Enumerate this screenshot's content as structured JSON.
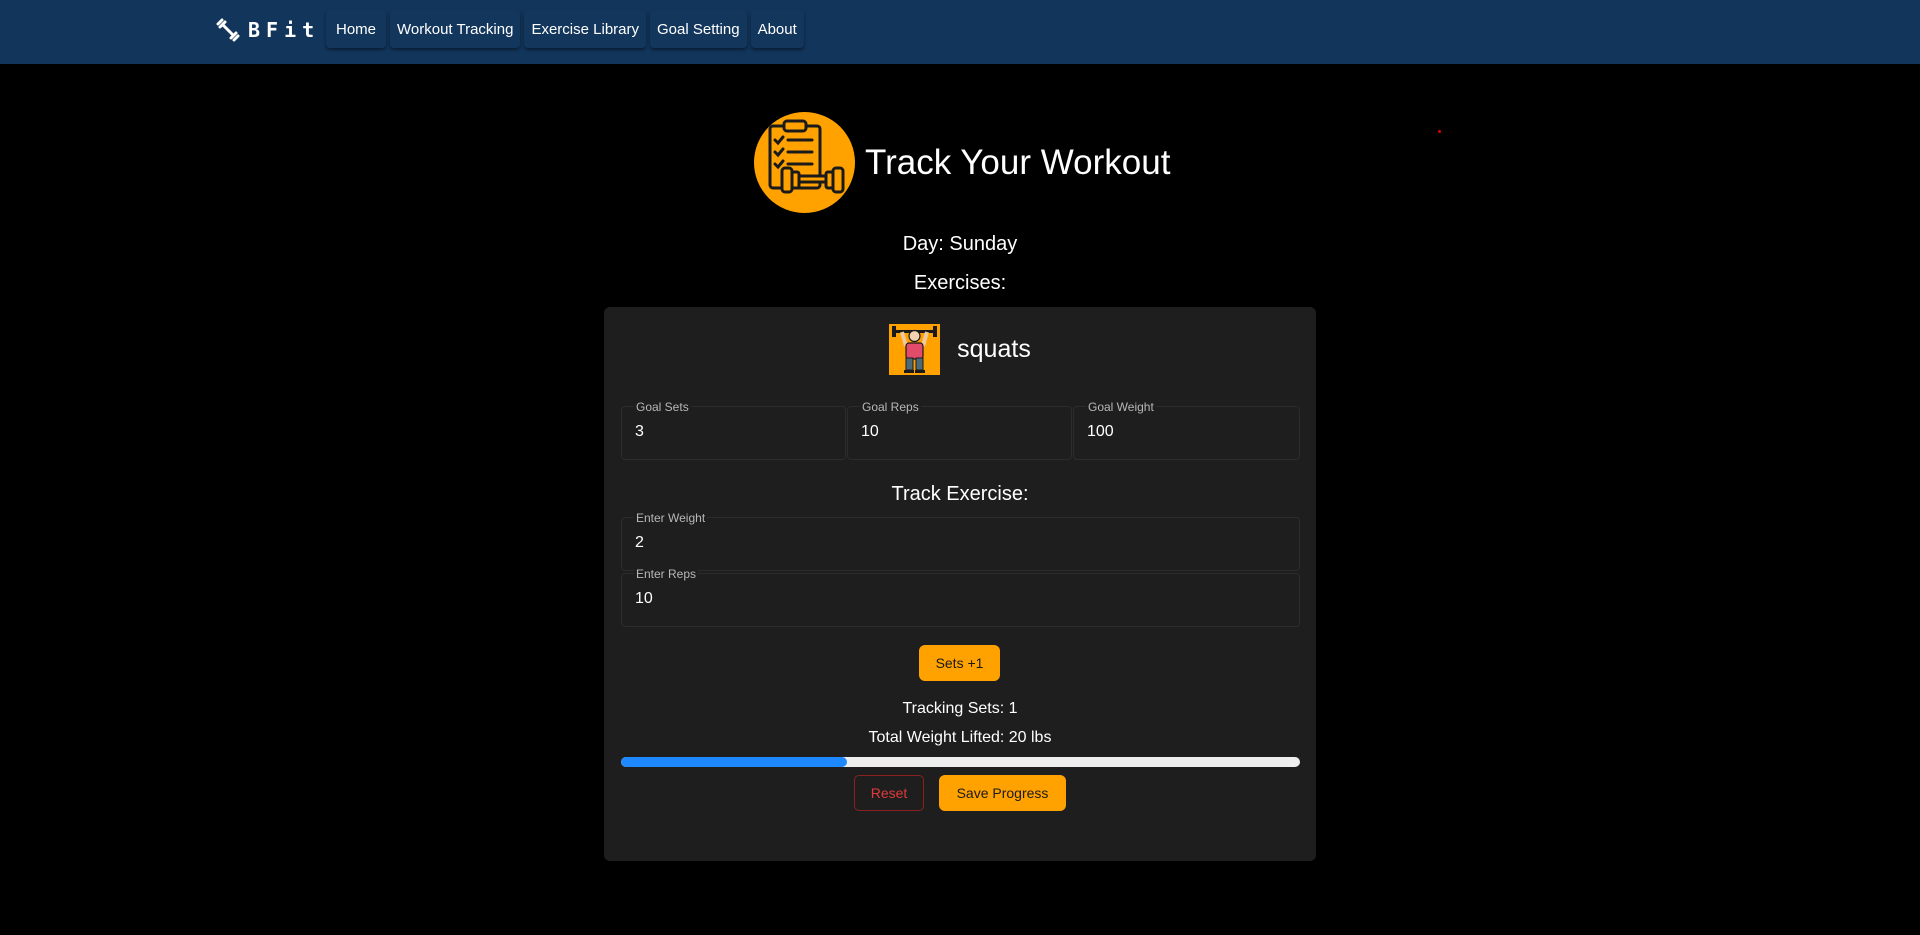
{
  "nav": {
    "brand": "BFit",
    "brand_icon": "dumbbell-icon",
    "links": [
      {
        "label": "Home"
      },
      {
        "label": "Workout Tracking"
      },
      {
        "label": "Exercise Library"
      },
      {
        "label": "Goal Setting"
      },
      {
        "label": "About"
      }
    ]
  },
  "header": {
    "title": "Track Your Workout",
    "icon": "clipboard-dumbbell-icon"
  },
  "day": "Day: Sunday",
  "exercises_label": "Exercises:",
  "exercise": {
    "name": "squats",
    "thumb_icon": "weightlifter-icon",
    "goals": [
      {
        "label": "Goal Sets",
        "value": "3"
      },
      {
        "label": "Goal Reps",
        "value": "10"
      },
      {
        "label": "Goal Weight",
        "value": "100"
      }
    ],
    "track_title": "Track Exercise:",
    "weight_field": {
      "label": "Enter Weight",
      "value": "2"
    },
    "reps_field": {
      "label": "Enter Reps",
      "value": "10"
    },
    "sets_button": "Sets +1",
    "tracking_sets": "Tracking Sets: 1",
    "total_weight": "Total Weight Lifted: 20 lbs",
    "progress_percent": 33.3,
    "reset_button": "Reset",
    "save_button": "Save Progress"
  },
  "colors": {
    "navbar": "#12355b",
    "accent": "#ffa200",
    "progress": "#1e88ff",
    "danger": "#e03a3a",
    "card": "#1e1e1e"
  }
}
